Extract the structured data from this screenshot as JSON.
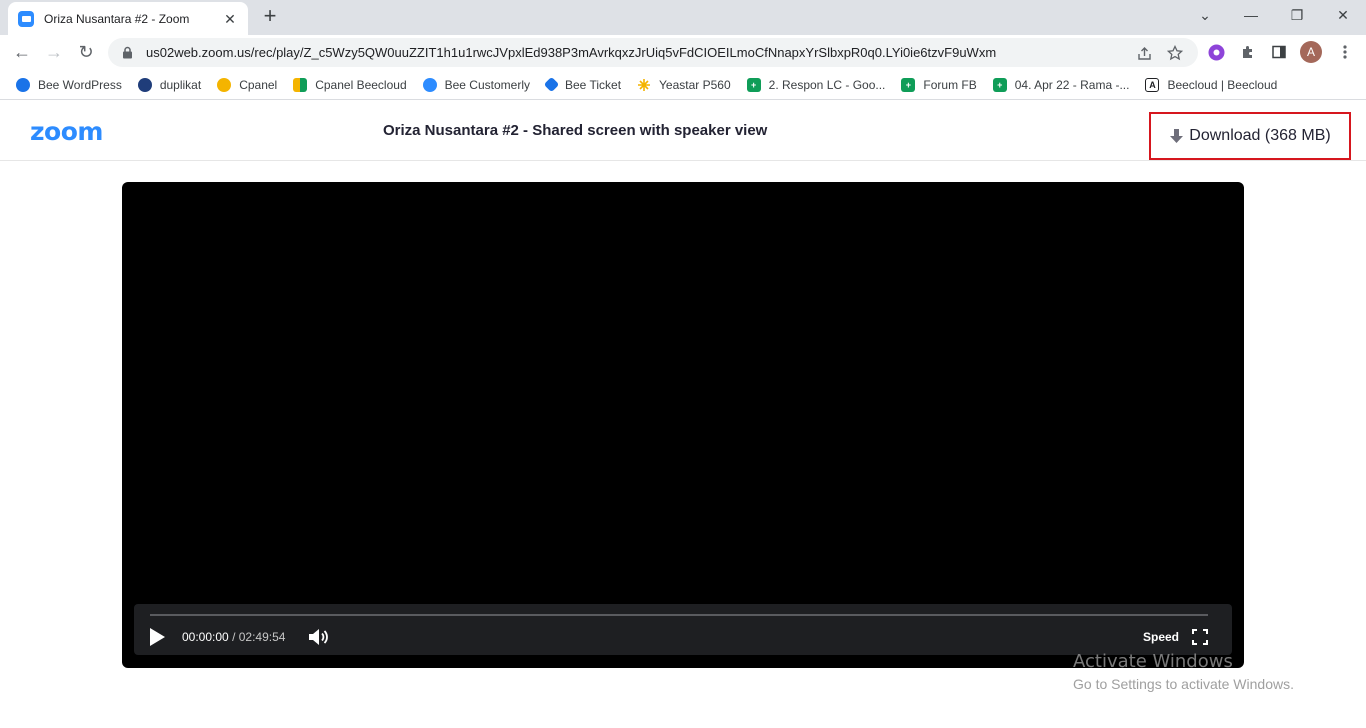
{
  "browser": {
    "tab": {
      "title": "Oriza Nusantara #2 - Zoom",
      "close": "✕",
      "favicon": "zoom-icon"
    },
    "new_tab": "+",
    "window_controls": {
      "collapse": "⌄",
      "minimize": "—",
      "restore": "❐",
      "close": "✕"
    },
    "toolbar": {
      "back": "←",
      "forward": "→",
      "reload": "↻",
      "url": "us02web.zoom.us/rec/play/Z_c5Wzy5QW0uuZZIT1h1u1rwcJVpxlEd938P3mAvrkqxzJrUiq5vFdCIOEILmoCfNnapxYrSlbxpR0q0.LYi0ie6tzvF9uWxm",
      "profile_initial": "A"
    },
    "bookmarks": [
      {
        "label": "Bee WordPress",
        "icon": "bee-icon",
        "color": "#1a73e8"
      },
      {
        "label": "duplikat",
        "icon": "bee-icon",
        "color": "#1f3d7a"
      },
      {
        "label": "Cpanel",
        "icon": "cpanel-icon",
        "color": "#f4b400"
      },
      {
        "label": "Cpanel Beecloud",
        "icon": "windows-icon",
        "color": "#f4b400"
      },
      {
        "label": "Bee Customerly",
        "icon": "customerly-icon",
        "color": "#2d8cff"
      },
      {
        "label": "Bee Ticket",
        "icon": "ticket-icon",
        "color": "#1a73e8"
      },
      {
        "label": "Yeastar P560",
        "icon": "yeastar-icon",
        "color": "#f4b400"
      },
      {
        "label": "2. Respon LC - Goo...",
        "icon": "sheets-icon",
        "color": "#0f9d58"
      },
      {
        "label": "Forum FB",
        "icon": "sheets-icon",
        "color": "#0f9d58"
      },
      {
        "label": "04. Apr 22 - Rama -...",
        "icon": "sheets-icon",
        "color": "#0f9d58"
      },
      {
        "label": "Beecloud | Beecloud",
        "icon": "a-letter-icon",
        "color": "#202124"
      }
    ]
  },
  "zoom": {
    "logo": "zoom",
    "recording_title": "Oriza Nusantara #2 - Shared screen with speaker view",
    "download_label": "Download (368 MB)"
  },
  "player": {
    "current_time": "00:00:00",
    "separator": "/",
    "duration": "02:49:54",
    "speed_label": "Speed",
    "progress": 0
  },
  "watermark": {
    "line1": "Activate Windows",
    "line2": "Go to Settings to activate Windows."
  },
  "colors": {
    "zoom_blue": "#2d8cff",
    "highlight_red": "#d6161e"
  }
}
